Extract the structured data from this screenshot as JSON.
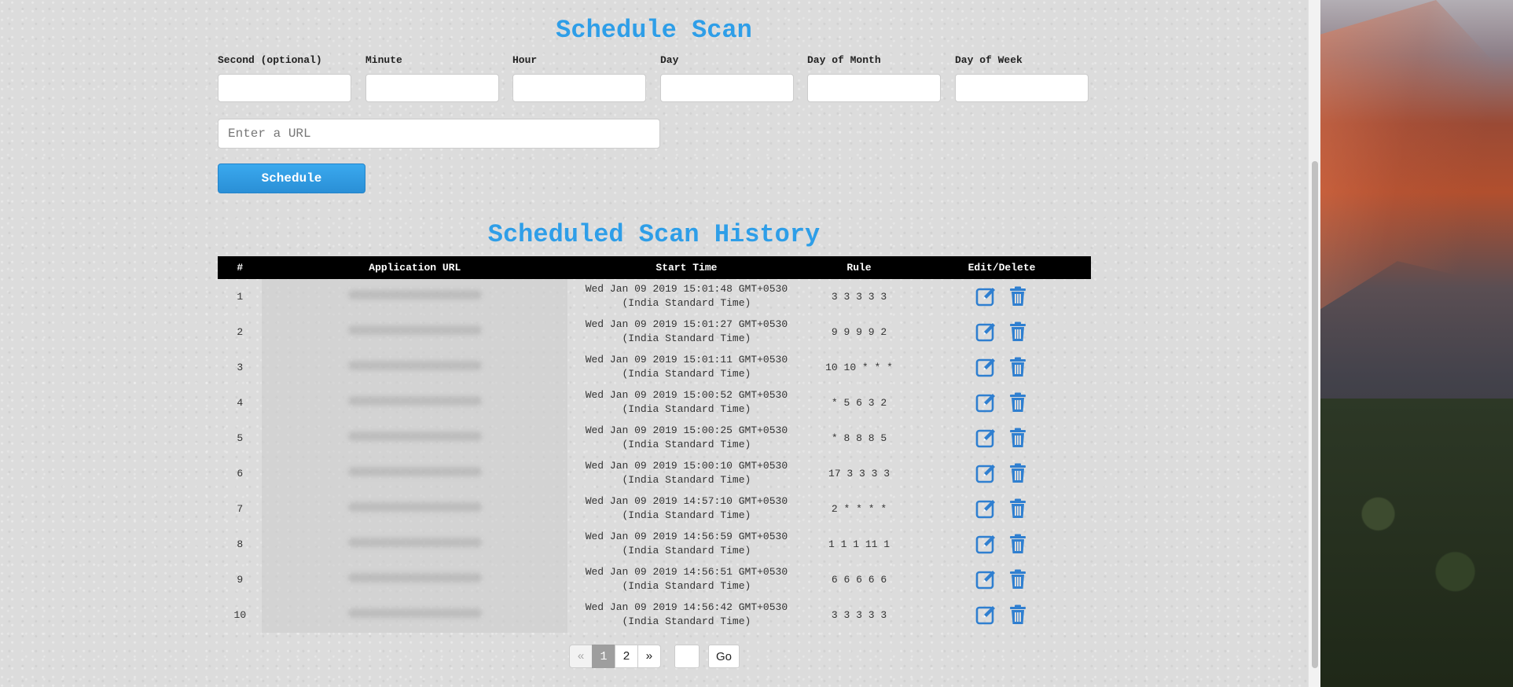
{
  "page": {
    "title": "Schedule Scan",
    "history_title": "Scheduled Scan History"
  },
  "fields": [
    {
      "label": "Second (optional)",
      "value": ""
    },
    {
      "label": "Minute",
      "value": ""
    },
    {
      "label": "Hour",
      "value": ""
    },
    {
      "label": "Day",
      "value": ""
    },
    {
      "label": "Day of Month",
      "value": ""
    },
    {
      "label": "Day of Week",
      "value": ""
    }
  ],
  "url_input": {
    "placeholder": "Enter a URL",
    "value": ""
  },
  "schedule_button": {
    "label": "Schedule"
  },
  "table": {
    "headers": [
      "#",
      "Application URL",
      "Start Time",
      "Rule",
      "Edit/Delete"
    ],
    "rows": [
      {
        "num": "1",
        "start_time_line1": "Wed Jan 09 2019 15:01:48 GMT+0530",
        "start_time_line2": "(India Standard Time)",
        "rule": "3 3 3 3 3"
      },
      {
        "num": "2",
        "start_time_line1": "Wed Jan 09 2019 15:01:27 GMT+0530",
        "start_time_line2": "(India Standard Time)",
        "rule": "9 9 9 9 2"
      },
      {
        "num": "3",
        "start_time_line1": "Wed Jan 09 2019 15:01:11 GMT+0530",
        "start_time_line2": "(India Standard Time)",
        "rule": "10 10 * * *"
      },
      {
        "num": "4",
        "start_time_line1": "Wed Jan 09 2019 15:00:52 GMT+0530",
        "start_time_line2": "(India Standard Time)",
        "rule": "* 5 6 3 2"
      },
      {
        "num": "5",
        "start_time_line1": "Wed Jan 09 2019 15:00:25 GMT+0530",
        "start_time_line2": "(India Standard Time)",
        "rule": "* 8 8 8 5"
      },
      {
        "num": "6",
        "start_time_line1": "Wed Jan 09 2019 15:00:10 GMT+0530",
        "start_time_line2": "(India Standard Time)",
        "rule": "17 3 3 3 3"
      },
      {
        "num": "7",
        "start_time_line1": "Wed Jan 09 2019 14:57:10 GMT+0530",
        "start_time_line2": "(India Standard Time)",
        "rule": "2 * * * *"
      },
      {
        "num": "8",
        "start_time_line1": "Wed Jan 09 2019 14:56:59 GMT+0530",
        "start_time_line2": "(India Standard Time)",
        "rule": "1 1 1 11 1"
      },
      {
        "num": "9",
        "start_time_line1": "Wed Jan 09 2019 14:56:51 GMT+0530",
        "start_time_line2": "(India Standard Time)",
        "rule": "6 6 6 6 6"
      },
      {
        "num": "10",
        "start_time_line1": "Wed Jan 09 2019 14:56:42 GMT+0530",
        "start_time_line2": "(India Standard Time)",
        "rule": "3 3 3 3 3"
      }
    ]
  },
  "pagination": {
    "prev": "«",
    "pages": [
      "1",
      "2"
    ],
    "current": "1",
    "next": "»",
    "go_label": "Go"
  },
  "icons": {
    "edit": "edit-icon",
    "delete": "trash-icon"
  },
  "colors": {
    "accent": "#2e9ee8",
    "icon_blue": "#2f7fd0",
    "header_bg": "#000000"
  }
}
